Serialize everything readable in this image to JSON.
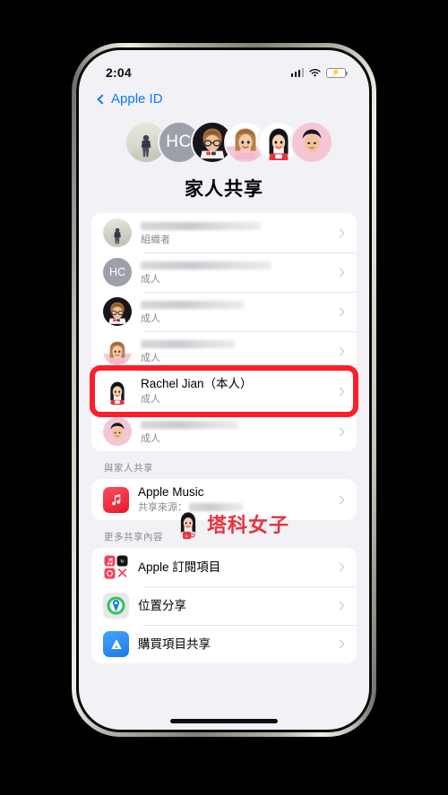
{
  "status_bar": {
    "time": "2:04",
    "signal_icon": "cellular-bars-icon",
    "wifi_icon": "wifi-icon",
    "battery_icon": "battery-charging-icon",
    "battery_charging": true
  },
  "nav": {
    "back_label": "Apple ID",
    "back_icon": "chevron-left-icon"
  },
  "header": {
    "title": "家人共享",
    "avatars": [
      {
        "name": "organizer-photo-avatar",
        "type": "photo",
        "initials": ""
      },
      {
        "name": "initials-avatar-hc",
        "type": "initials",
        "initials": "HC"
      },
      {
        "name": "memoji-avatar-glasses",
        "type": "memoji",
        "initials": ""
      },
      {
        "name": "memoji-avatar-long-hair",
        "type": "memoji",
        "initials": ""
      },
      {
        "name": "memoji-avatar-rachel",
        "type": "memoji",
        "initials": ""
      },
      {
        "name": "memoji-avatar-short-hair",
        "type": "memoji",
        "initials": ""
      }
    ]
  },
  "members": [
    {
      "name_redacted": true,
      "name": "",
      "role": "組織者",
      "avatar": "organizer-photo-avatar",
      "highlighted": false
    },
    {
      "name_redacted": true,
      "name": "",
      "role": "成人",
      "avatar": "initials-avatar-hc",
      "highlighted": false
    },
    {
      "name_redacted": true,
      "name": "",
      "role": "成人",
      "avatar": "memoji-avatar-glasses",
      "highlighted": false
    },
    {
      "name_redacted": true,
      "name": "",
      "role": "成人",
      "avatar": "memoji-avatar-long-hair",
      "highlighted": false
    },
    {
      "name_redacted": false,
      "name": "Rachel Jian（本人）",
      "role": "成人",
      "avatar": "memoji-avatar-rachel",
      "highlighted": true
    },
    {
      "name_redacted": true,
      "name": "",
      "role": "成人",
      "avatar": "memoji-avatar-short-hair",
      "highlighted": false
    }
  ],
  "shared_section": {
    "header": "與家人共享",
    "items": [
      {
        "label": "Apple Music",
        "sub_prefix": "共享來源：",
        "sub_redacted": true,
        "icon": "apple-music-icon"
      }
    ]
  },
  "more_section": {
    "header": "更多共享內容",
    "items": [
      {
        "label": "Apple 訂閱項目",
        "icon": "apple-subscriptions-icon"
      },
      {
        "label": "位置分享",
        "icon": "find-my-icon"
      },
      {
        "label": "購買項目共享",
        "icon": "app-store-icon"
      }
    ]
  },
  "watermark": {
    "text": "塔科女子",
    "figure_icon": "memoji-mascot-icon",
    "color": "#e8333c"
  },
  "highlight": {
    "color": "#ff1e28",
    "target": "Rachel Jian（本人）"
  },
  "home_indicator": "home-indicator"
}
